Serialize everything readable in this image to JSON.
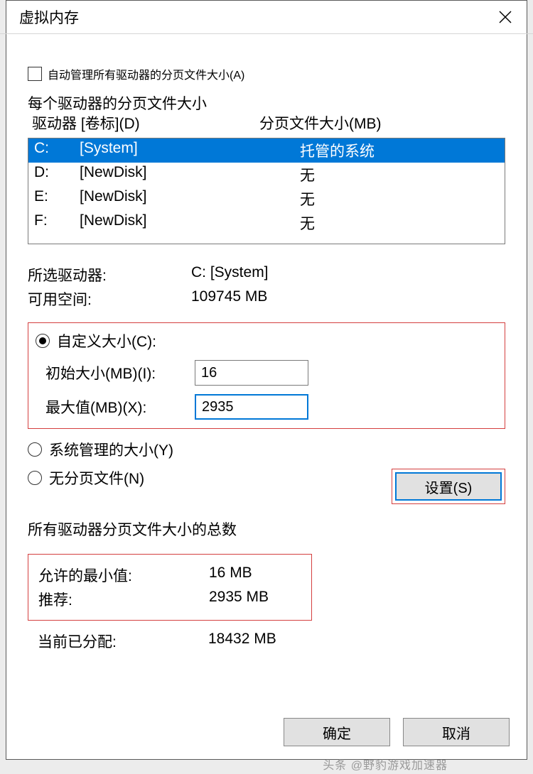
{
  "window": {
    "title": "虚拟内存"
  },
  "auto_manage": {
    "label": "自动管理所有驱动器的分页文件大小(A)",
    "checked": false
  },
  "drives_section": {
    "title": "每个驱动器的分页文件大小",
    "header_drive": "驱动器 [卷标](D)",
    "header_size": "分页文件大小(MB)",
    "rows": [
      {
        "letter": "C:",
        "label": "[System]",
        "size": "托管的系统",
        "selected": true
      },
      {
        "letter": "D:",
        "label": "[NewDisk]",
        "size": "无",
        "selected": false
      },
      {
        "letter": "E:",
        "label": "[NewDisk]",
        "size": "无",
        "selected": false
      },
      {
        "letter": "F:",
        "label": "[NewDisk]",
        "size": "无",
        "selected": false
      }
    ]
  },
  "selected_drive": {
    "label": "所选驱动器:",
    "value": "C:  [System]"
  },
  "free_space": {
    "label": "可用空间:",
    "value": "109745 MB"
  },
  "custom_size": {
    "radio_label": "自定义大小(C):",
    "initial_label": "初始大小(MB)(I):",
    "initial_value": "16",
    "max_label": "最大值(MB)(X):",
    "max_value": "2935"
  },
  "system_managed": {
    "label": "系统管理的大小(Y)"
  },
  "no_paging": {
    "label": "无分页文件(N)"
  },
  "set_button": "设置(S)",
  "totals_section": {
    "title": "所有驱动器分页文件大小的总数",
    "min_label": "允许的最小值:",
    "min_value": "16 MB",
    "rec_label": "推荐:",
    "rec_value": "2935 MB",
    "cur_label": "当前已分配:",
    "cur_value": "18432 MB"
  },
  "buttons": {
    "ok": "确定",
    "cancel": "取消"
  },
  "watermark": "头条 @野豹游戏加速器"
}
